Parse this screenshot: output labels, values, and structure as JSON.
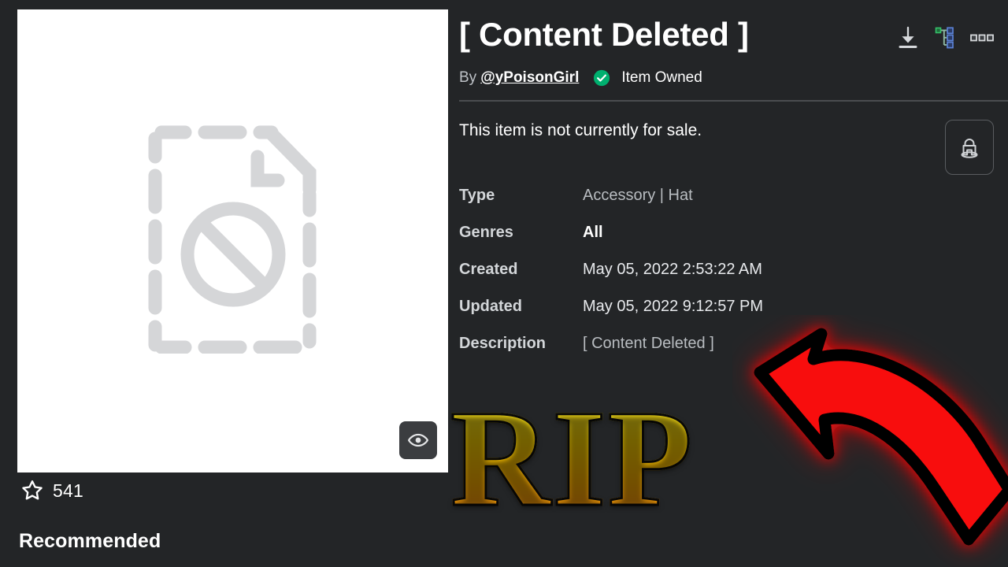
{
  "theme": {
    "page_background": "#232527",
    "card_background": "#ffffff",
    "text_primary": "#ffffff",
    "text_secondary": "#b9bdc1",
    "divider": "#4a4d50",
    "verified_green": "#00b06f",
    "accent_red": "#fa0505",
    "rip_gradient_top": "#fff23a",
    "rip_gradient_bottom": "#ff9416"
  },
  "item": {
    "title": "[ Content Deleted ]",
    "by_prefix": "By",
    "creator": "@yPoisonGirl",
    "verified_icon": "verified-check-icon",
    "ownership_status": "Item Owned",
    "sale_status": "This item is not currently for sale.",
    "favorites_icon": "star-icon",
    "favorites_count": "541"
  },
  "title_actions": [
    {
      "name": "download-icon",
      "label": "Download"
    },
    {
      "name": "tree-hierarchy-icon",
      "label": "Hierarchy"
    },
    {
      "name": "more-options-icon",
      "label": "More"
    }
  ],
  "thumbnail": {
    "placeholder_icon": "deleted-content-placeholder-icon",
    "preview_icon": "eye-icon"
  },
  "tryon": {
    "icon": "avatar-try-on-icon",
    "label": "Try On"
  },
  "details": {
    "rows": [
      {
        "label": "Type",
        "value": "Accessory | Hat",
        "style": "muted"
      },
      {
        "label": "Genres",
        "value": "All",
        "style": "strong"
      },
      {
        "label": "Created",
        "value": "May 05, 2022 2:53:22 AM",
        "style": "normal"
      },
      {
        "label": "Updated",
        "value": "May 05, 2022 9:12:57 PM",
        "style": "normal"
      },
      {
        "label": "Description",
        "value": "[ Content Deleted ]",
        "style": "muted"
      }
    ]
  },
  "sections": {
    "recommended_heading": "Recommended"
  },
  "overlay": {
    "rip_text": "RIP",
    "arrow_icon": "red-curved-arrow-icon",
    "arrow_direction": "up-left"
  }
}
